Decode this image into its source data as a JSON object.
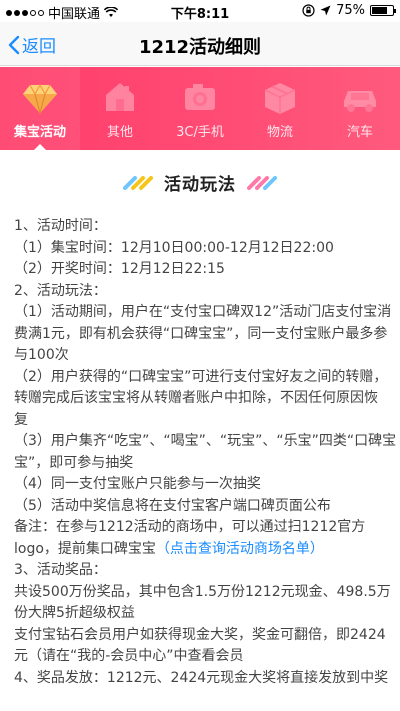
{
  "status_bar": {
    "carrier": "中国联通",
    "time": "下午8:11",
    "battery": "75%",
    "battery_level": 0.75,
    "signal_bars": 3
  },
  "nav": {
    "back_label": "返回",
    "title": "1212活动细则"
  },
  "categories": [
    {
      "label": "集宝活动",
      "icon": "treasure-icon",
      "active": true
    },
    {
      "label": "其他",
      "icon": "house-icon",
      "active": false
    },
    {
      "label": "3C/手机",
      "icon": "camera-icon",
      "active": false
    },
    {
      "label": "物流",
      "icon": "package-icon",
      "active": false
    },
    {
      "label": "汽车",
      "icon": "car-icon",
      "active": false
    }
  ],
  "section": {
    "title": "活动玩法"
  },
  "content": {
    "l1": "1、活动时间：",
    "l2": "（1）集宝时间：12月10日00:00-12月12日22:00",
    "l3": "（2）开奖时间：12月12日22:15",
    "l4": "2、活动玩法：",
    "l5": "（1）活动期间，用户在“支付宝口碑双12”活动门店支付宝消",
    "l6": "费满1元，即有机会获得“口碑宝宝”，同一支付宝账户最多参",
    "l7": "与100次",
    "l8": "（2）用户获得的“口碑宝宝”可进行支付宝好友之间的转赠，",
    "l9": "转赠完成后该宝宝将从转赠者账户中扣除，不因任何原因恢",
    "l10": "复",
    "l11": "（3）用户集齐“吃宝”、“喝宝”、“玩宝”、“乐宝”四类“口碑宝",
    "l12": "宝”，即可参与抽奖",
    "l13": "（4）同一支付宝账户只能参与一次抽奖",
    "l14": "（5）活动中奖信息将在支付宝客户端口碑页面公布",
    "l15": "备注：在参与1212活动的商场中，可以通过扫1212官方",
    "l16_text": "logo，提前集口碑宝宝",
    "l16_link": "（点击查询活动商场名单）",
    "l17": "3、活动奖品：",
    "l18": "共设500万份奖品，其中包含1.5万份1212元现金、498.5万",
    "l19": "份大牌5折超级权益",
    "l20": "支付宝钻石会员用户如获得现金大奖，奖金可翻倍，即2424",
    "l21": "元（请在“我的-会员中心”中查看会员",
    "l22": "4、奖品发放：1212元、2424元现金大奖将直接发放到中奖"
  },
  "colors": {
    "banner": "#ff4a74",
    "link": "#1a8cff",
    "deco_yellow": "#f5c518",
    "deco_pink": "#ff7aa8",
    "deco_blue": "#6ec6ff"
  }
}
